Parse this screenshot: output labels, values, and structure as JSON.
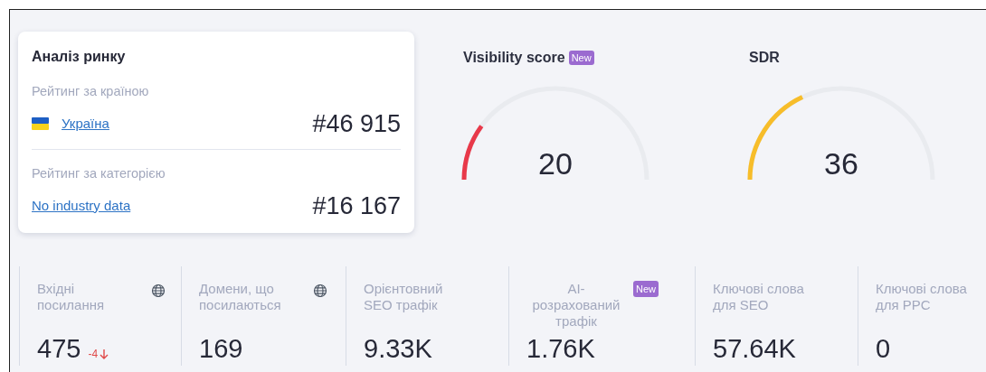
{
  "market_card": {
    "title": "Аналіз ринку",
    "sections": [
      {
        "label": "Рейтинг за країною",
        "link": "Україна",
        "flag": true,
        "rank": "#46 915"
      },
      {
        "label": "Рейтинг за категорією",
        "link": "No industry data",
        "flag": false,
        "rank": "#16 167"
      }
    ]
  },
  "gauges": [
    {
      "title": "Visibility score",
      "badge": "New",
      "value": "20",
      "color": "#e8394a"
    },
    {
      "title": "SDR",
      "value": "36",
      "color": "#f7bd2a"
    }
  ],
  "stats": [
    {
      "label": "Вхідні посилання",
      "value": "475",
      "change": "-4",
      "globe": true
    },
    {
      "label": "Домени, що посилаються",
      "value": "169",
      "globe": true
    },
    {
      "label": "Орієнтовний SEO трафік",
      "value": "9.33K",
      "globe": false
    },
    {
      "label": "AI-розрахований трафік",
      "badge": "New",
      "value": "1.76K",
      "globe": false
    },
    {
      "label": "Ключові слова для SEO",
      "value": "57.64K",
      "globe": false
    },
    {
      "label": "Ключові слова для PPC",
      "value": "0",
      "globe": false
    }
  ]
}
